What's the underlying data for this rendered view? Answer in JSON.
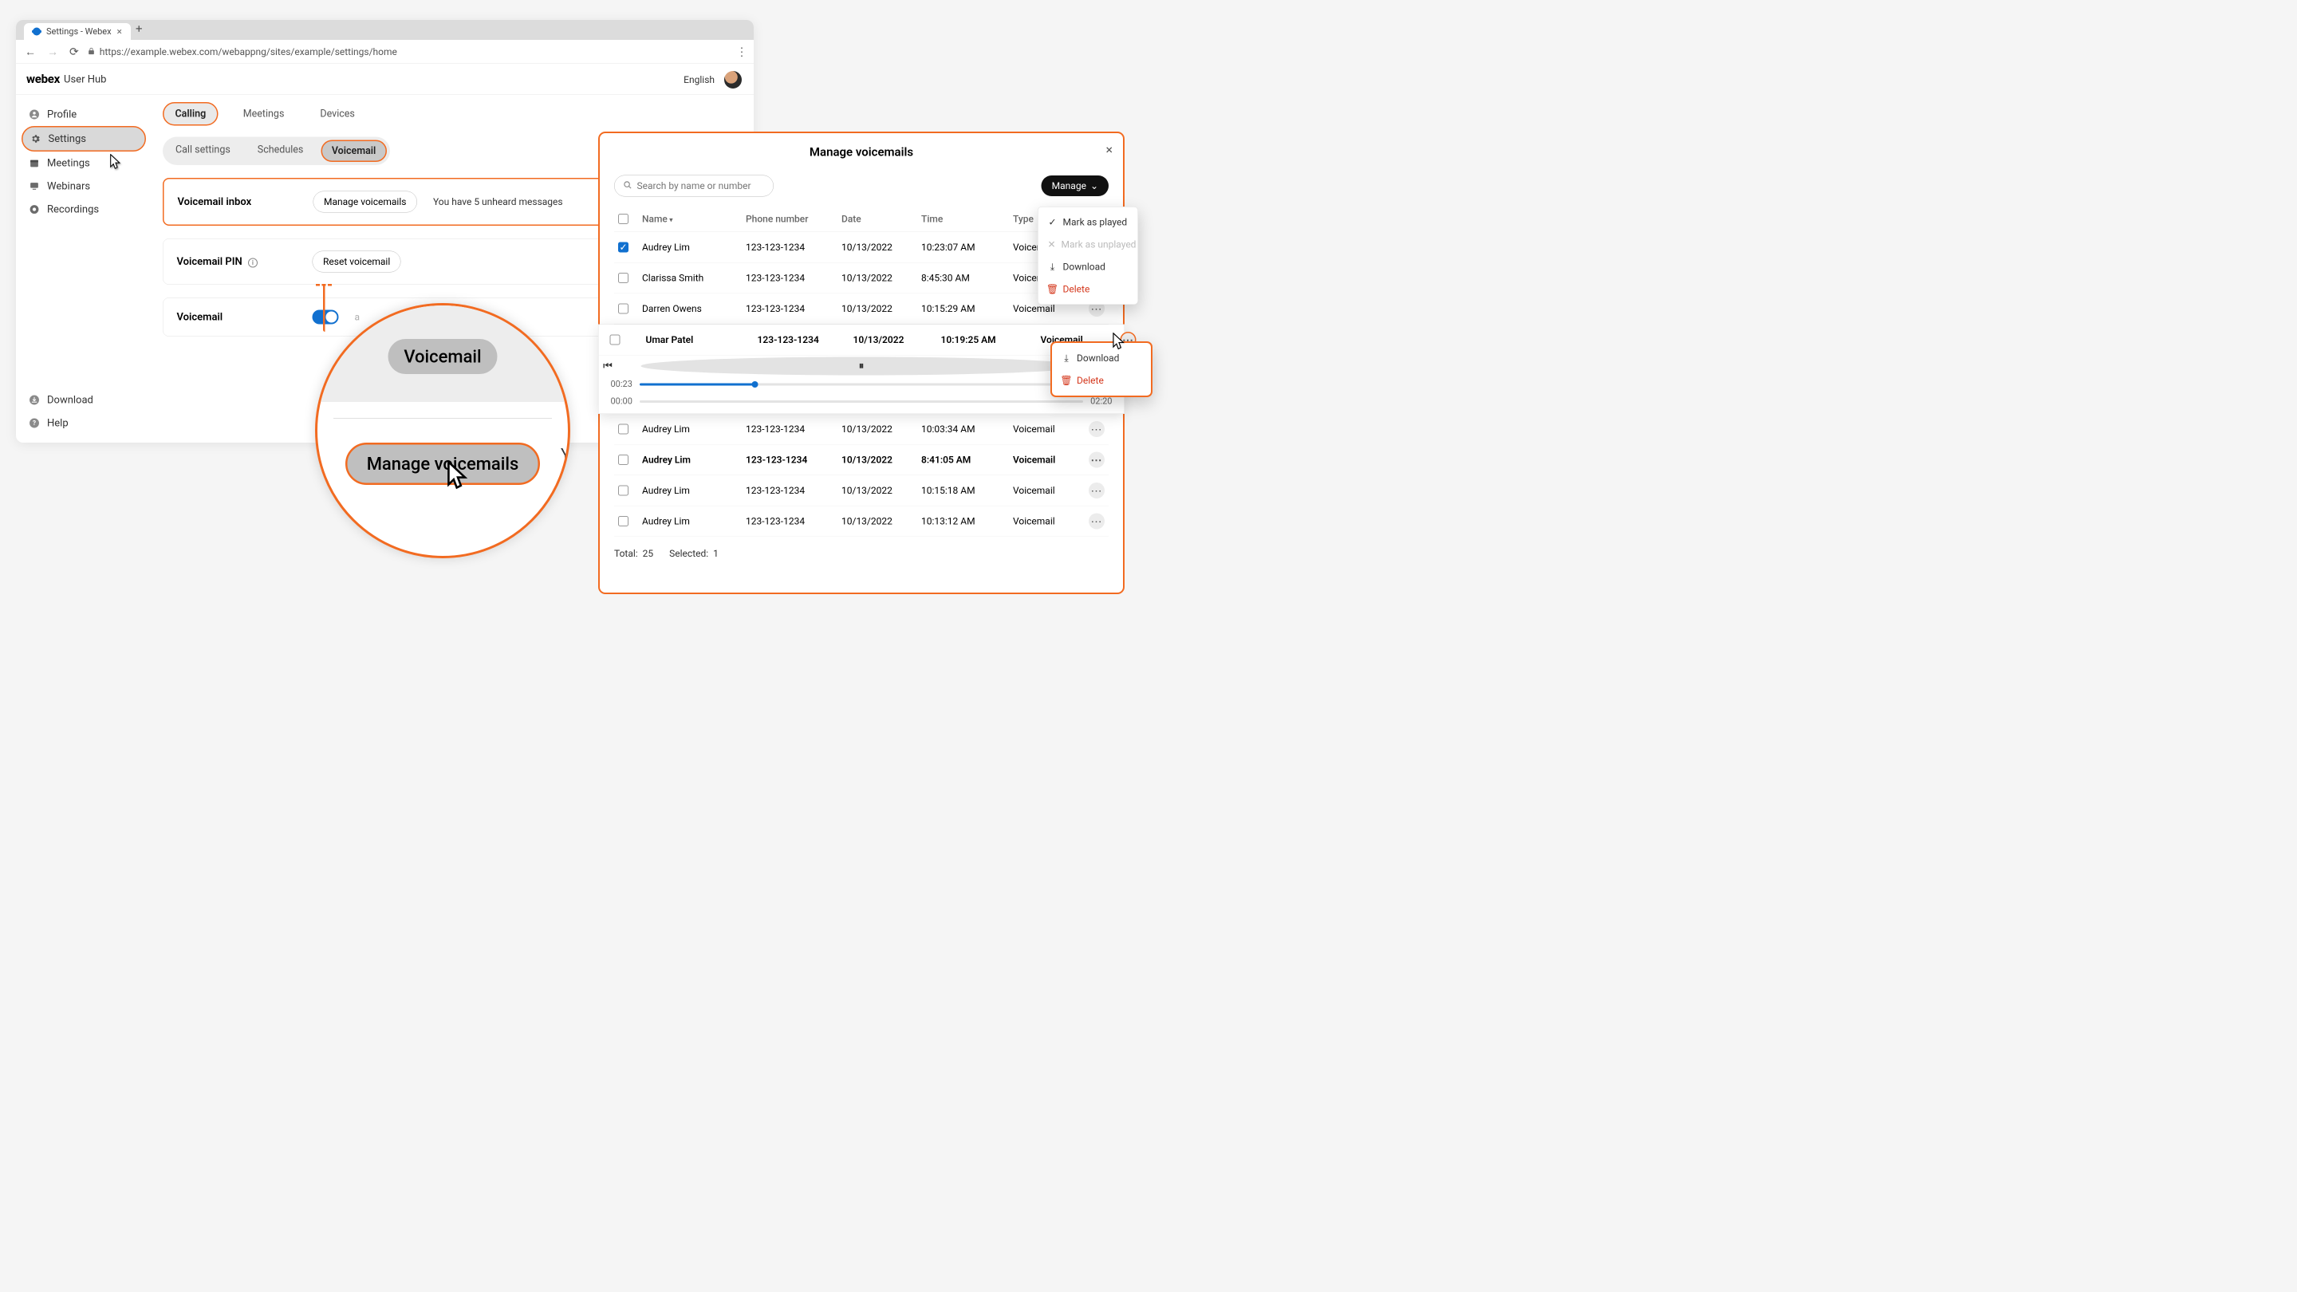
{
  "browser": {
    "tab_title": "Settings - Webex",
    "url": "https://example.webex.com/webappng/sites/example/settings/home"
  },
  "brand": {
    "name": "webex",
    "sub": "User Hub"
  },
  "sidebar": {
    "items": [
      {
        "label": "Profile"
      },
      {
        "label": "Settings"
      },
      {
        "label": "Meetings"
      },
      {
        "label": "Webinars"
      },
      {
        "label": "Recordings"
      }
    ],
    "bottom": [
      {
        "label": "Download"
      },
      {
        "label": "Help"
      }
    ]
  },
  "header_right": {
    "language": "English"
  },
  "tabs_primary": [
    "Calling",
    "Meetings",
    "Devices"
  ],
  "tabs_secondary": [
    "Call settings",
    "Schedules",
    "Voicemail"
  ],
  "cards": {
    "inbox": {
      "title": "Voicemail inbox",
      "button": "Manage voicemails",
      "text": "You have 5 unheard messages"
    },
    "pin": {
      "title": "Voicemail PIN",
      "button": "Reset voicemail"
    },
    "vm": {
      "title": "Voicemail"
    }
  },
  "magnifier": {
    "tab": "Voicemail",
    "button": "Manage voicemails"
  },
  "modal": {
    "title": "Manage voicemails",
    "search_placeholder": "Search by name or number",
    "manage_label": "Manage",
    "columns": [
      "Name",
      "Phone number",
      "Date",
      "Time",
      "Type"
    ],
    "rows": [
      {
        "name": "Audrey Lim",
        "phone": "123-123-1234",
        "date": "10/13/2022",
        "time": "10:23:07 AM",
        "type": "Voicemail",
        "checked": true
      },
      {
        "name": "Clarissa Smith",
        "phone": "123-123-1234",
        "date": "10/13/2022",
        "time": "8:45:30 AM",
        "type": "Voicemail"
      },
      {
        "name": "Darren Owens",
        "phone": "123-123-1234",
        "date": "10/13/2022",
        "time": "10:15:29 AM",
        "type": "Voicemail"
      }
    ],
    "player": {
      "name": "Umar Patel",
      "phone": "123-123-1234",
      "date": "10/13/2022",
      "time": "10:19:25 AM",
      "type": "Voicemail",
      "elapsed": "00:23",
      "duration": "02:20",
      "progress_pct": 26,
      "extra_elapsed": "00:00",
      "extra_duration": "02:20"
    },
    "rows_after": [
      {
        "name": "Audrey Lim",
        "phone": "123-123-1234",
        "date": "10/13/2022",
        "time": "10:03:34 AM",
        "type": "Voicemail"
      },
      {
        "name": "Audrey Lim",
        "phone": "123-123-1234",
        "date": "10/13/2022",
        "time": "8:41:05 AM",
        "type": "Voicemail",
        "bold": true
      },
      {
        "name": "Audrey Lim",
        "phone": "123-123-1234",
        "date": "10/13/2022",
        "time": "10:15:18 AM",
        "type": "Voicemail"
      },
      {
        "name": "Audrey Lim",
        "phone": "123-123-1234",
        "date": "10/13/2022",
        "time": "10:13:12 AM",
        "type": "Voicemail"
      }
    ],
    "totals": {
      "total_label": "Total:",
      "total": "25",
      "selected_label": "Selected:",
      "selected": "1"
    },
    "manage_menu": [
      {
        "label": "Mark as played",
        "icon": "✓"
      },
      {
        "label": "Mark as unplayed",
        "icon": "✕",
        "disabled": true
      },
      {
        "label": "Download",
        "icon": "⤓"
      },
      {
        "label": "Delete",
        "icon": "🗑",
        "danger": true
      }
    ],
    "row_menu": [
      {
        "label": "Download",
        "icon": "⤓"
      },
      {
        "label": "Delete",
        "icon": "🗑",
        "danger": true
      }
    ]
  }
}
